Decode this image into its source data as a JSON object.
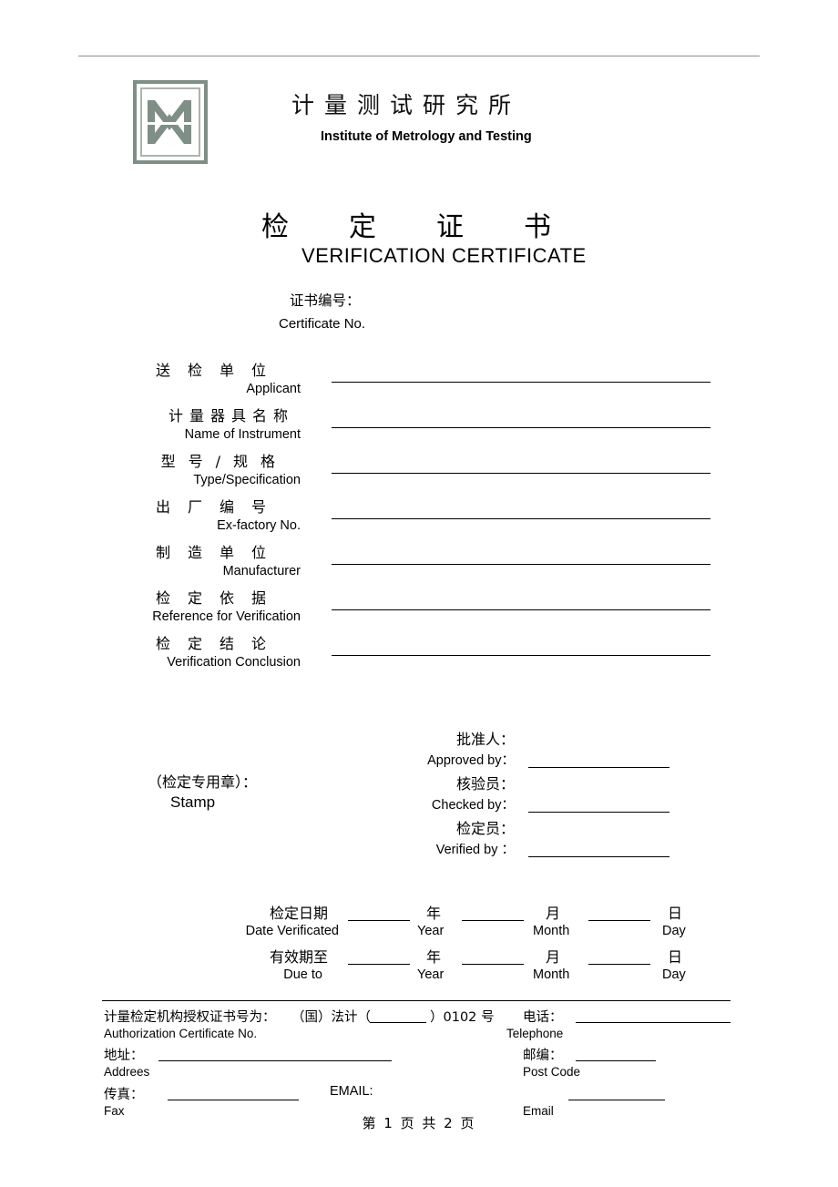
{
  "document": {
    "type": "verification-certificate",
    "page_indicator": "第 1 页 共 2 页"
  },
  "letterhead": {
    "logo_icon": "mw-monogram-logo",
    "logo_color": "#7e8f85",
    "org_name_cn": "计量测试研究所",
    "org_name_en": "Institute of Metrology and Testing"
  },
  "title": {
    "cn": "检定证书",
    "en": "VERIFICATION CERTIFICATE"
  },
  "certificate_no": {
    "cn": "证书编号：",
    "en": "Certificate No.",
    "value": ""
  },
  "fields": [
    {
      "cn": "送检单位",
      "en": "Applicant",
      "value": "",
      "spacing": "sp-wide"
    },
    {
      "cn": "计量器具名称",
      "en": "Name of Instrument",
      "value": "",
      "spacing": "sp-mid"
    },
    {
      "cn": "型号/规格",
      "en": "Type/Specification",
      "value": "",
      "spacing": "sp-tight"
    },
    {
      "cn": "出厂编号",
      "en": "Ex-factory No.",
      "value": "",
      "spacing": "sp-wide"
    },
    {
      "cn": "制造单位",
      "en": "Manufacturer",
      "value": "",
      "spacing": "sp-wide"
    },
    {
      "cn": "检定依据",
      "en": "Reference for Verification",
      "value": "",
      "spacing": "sp-wide"
    },
    {
      "cn": "检定结论",
      "en": "Verification Conclusion",
      "value": "",
      "spacing": "sp-wide"
    }
  ],
  "stamp": {
    "cn": "（检定专用章）：",
    "en": "Stamp"
  },
  "signatures": [
    {
      "cn": "批准人：",
      "en": "Approved   by：",
      "value": ""
    },
    {
      "cn": "核验员：",
      "en": "Checked by：",
      "value": ""
    },
    {
      "cn": "检定员：",
      "en": "Verified by ：",
      "value": ""
    }
  ],
  "dates": {
    "units": {
      "year_cn": "年",
      "year_en": "Year",
      "month_cn": "月",
      "month_en": "Month",
      "day_cn": "日",
      "day_en": "Day"
    },
    "rows": [
      {
        "cn": "检定日期",
        "en": "Date Verificated",
        "year": "",
        "month": "",
        "day": ""
      },
      {
        "cn": "有效期至",
        "en": "Due to",
        "year": "",
        "month": "",
        "day": ""
      }
    ]
  },
  "footer": {
    "authorization": {
      "cn": "计量检定机构授权证书号为：",
      "en": "Authorization Certificate No.",
      "number_prefix": "（国）法计（",
      "number_blank": "",
      "number_suffix": "）0102 号"
    },
    "telephone": {
      "cn": "电话：",
      "en": "Telephone",
      "value": ""
    },
    "address": {
      "cn": "地址：",
      "en": "Addrees",
      "value": ""
    },
    "postcode": {
      "cn": "邮编：",
      "en": "Post Code",
      "value": ""
    },
    "fax": {
      "cn": "传真：",
      "en": "Fax",
      "value": ""
    },
    "email": {
      "cn": "EMAIL:",
      "en": "Email",
      "value": ""
    }
  }
}
